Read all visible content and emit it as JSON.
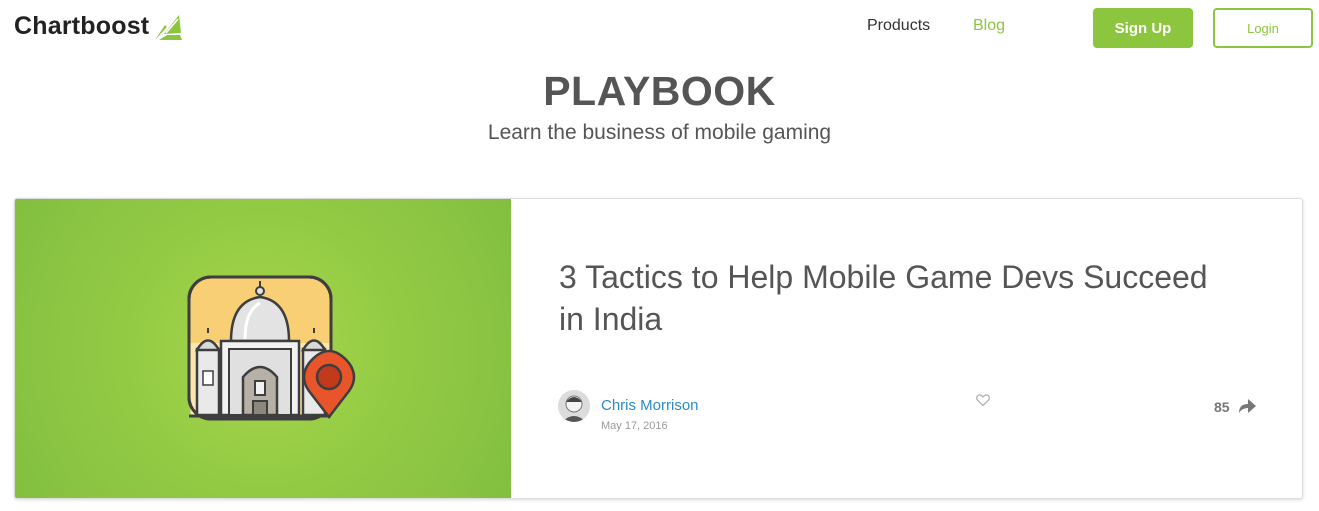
{
  "header": {
    "logo_text": "Chartboost",
    "logo_icon": "chartboost-leaf-icon",
    "nav": {
      "products_label": "Products",
      "blog_label": "Blog"
    },
    "signup_label": "Sign Up",
    "login_label": "Login"
  },
  "hero": {
    "title": "PLAYBOOK",
    "subtitle": "Learn the business of mobile gaming"
  },
  "featured_post": {
    "image_icon": "taj-mahal-location-pin-icon",
    "title": "3 Tactics to Help Mobile Game Devs Succeed in India",
    "author": "Chris Morrison",
    "date": "May 17, 2016",
    "like_icon": "heart-outline-icon",
    "share_count": "85",
    "share_icon": "share-arrow-icon"
  },
  "colors": {
    "brand_green": "#8cc63e",
    "link_blue": "#2a8bcb",
    "text_gray": "#555555"
  }
}
